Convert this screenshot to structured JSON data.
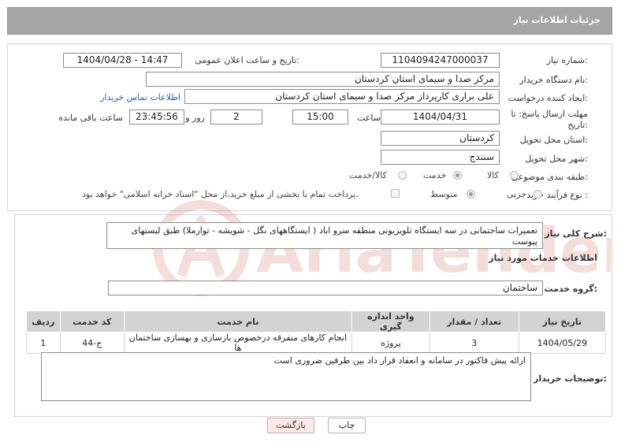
{
  "header": {
    "title": "جزئیات اطلاعات نیاز"
  },
  "form": {
    "need_number_label": "شماره نیاز:",
    "need_number": "1104094247000037",
    "announce_label": "تاریخ و ساعت اعلان عمومی:",
    "announce_value": "1404/04/28 - 14:47",
    "buyer_org_label": "نام دستگاه خریدار:",
    "buyer_org": "مرکز صدا و سیمای استان کردستان",
    "requester_label": "ایجاد کننده درخواست:",
    "requester": "علی براری کارپرداز مرکز صدا و سیمای استان کردستان",
    "contact_link": "اطلاعات تماس خریدار",
    "deadline_label_line1": "مهلت ارسال پاسخ: تا",
    "deadline_label_line2": "تاریخ:",
    "deadline_date": "1404/04/31",
    "time_label": "ساعت",
    "deadline_time": "15:00",
    "days_value": "2",
    "days_label": "روز و",
    "remaining_time": "23:45:56",
    "remaining_label": "ساعت باقی مانده",
    "province_label": "استان محل تحویل:",
    "province": "کردستان",
    "city_label": "شهر محل تحویل:",
    "city": "سنندج",
    "category_label": "طبقه بندی موضوعی:",
    "category_options": [
      "کالا",
      "خدمت",
      "کالا/خدمت"
    ],
    "category_selected": "خدمت",
    "process_label": "نوع فرآیند خرید :",
    "process_options": [
      "جزیی",
      "متوسط"
    ],
    "process_selected": "متوسط",
    "payment_note": "پرداخت تمام یا بخشی از مبلغ خرید،از محل \"اسناد خزانه اسلامی\" خواهد بود."
  },
  "description": {
    "label": "شرح کلی نیاز:",
    "text": "تعمیرات ساختمانی در سه ایستگاه تلویزیونی منطقه سرو اباد ( ایستگاههای نگل - شویشه - توارملا) طبق لیستهای پیوست"
  },
  "services": {
    "section_title": "اطلاعات خدمات مورد نیاز",
    "group_label": "گروه خدمت:",
    "group_value": "ساختمان",
    "columns": [
      "ردیف",
      "کد خدمت",
      "نام خدمت",
      "واحد اندازه گیری",
      "تعداد / مقدار",
      "تاریخ نیاز"
    ],
    "rows": [
      [
        "1",
        "ج-44",
        "انجام کارهای متفرقه درخصوص بازسازی و بهسازی ساختمان ها",
        "پروژه",
        "3",
        "1404/05/29"
      ]
    ]
  },
  "buyer_notes": {
    "label": "توضیحات خریدار:",
    "text": "ارائه پیش فاکتور در سامانه و انعقاد قرار داد بین طرفین ضروری است"
  },
  "buttons": {
    "print": "چاپ",
    "back": "بازگشت"
  },
  "watermark": {
    "text": "AriaTender.net"
  },
  "colors": {
    "header_bg": "#a5a5a5",
    "link": "#1f5fb5",
    "back_button_bg": "#fde8e8",
    "watermark": "#c0392b"
  }
}
